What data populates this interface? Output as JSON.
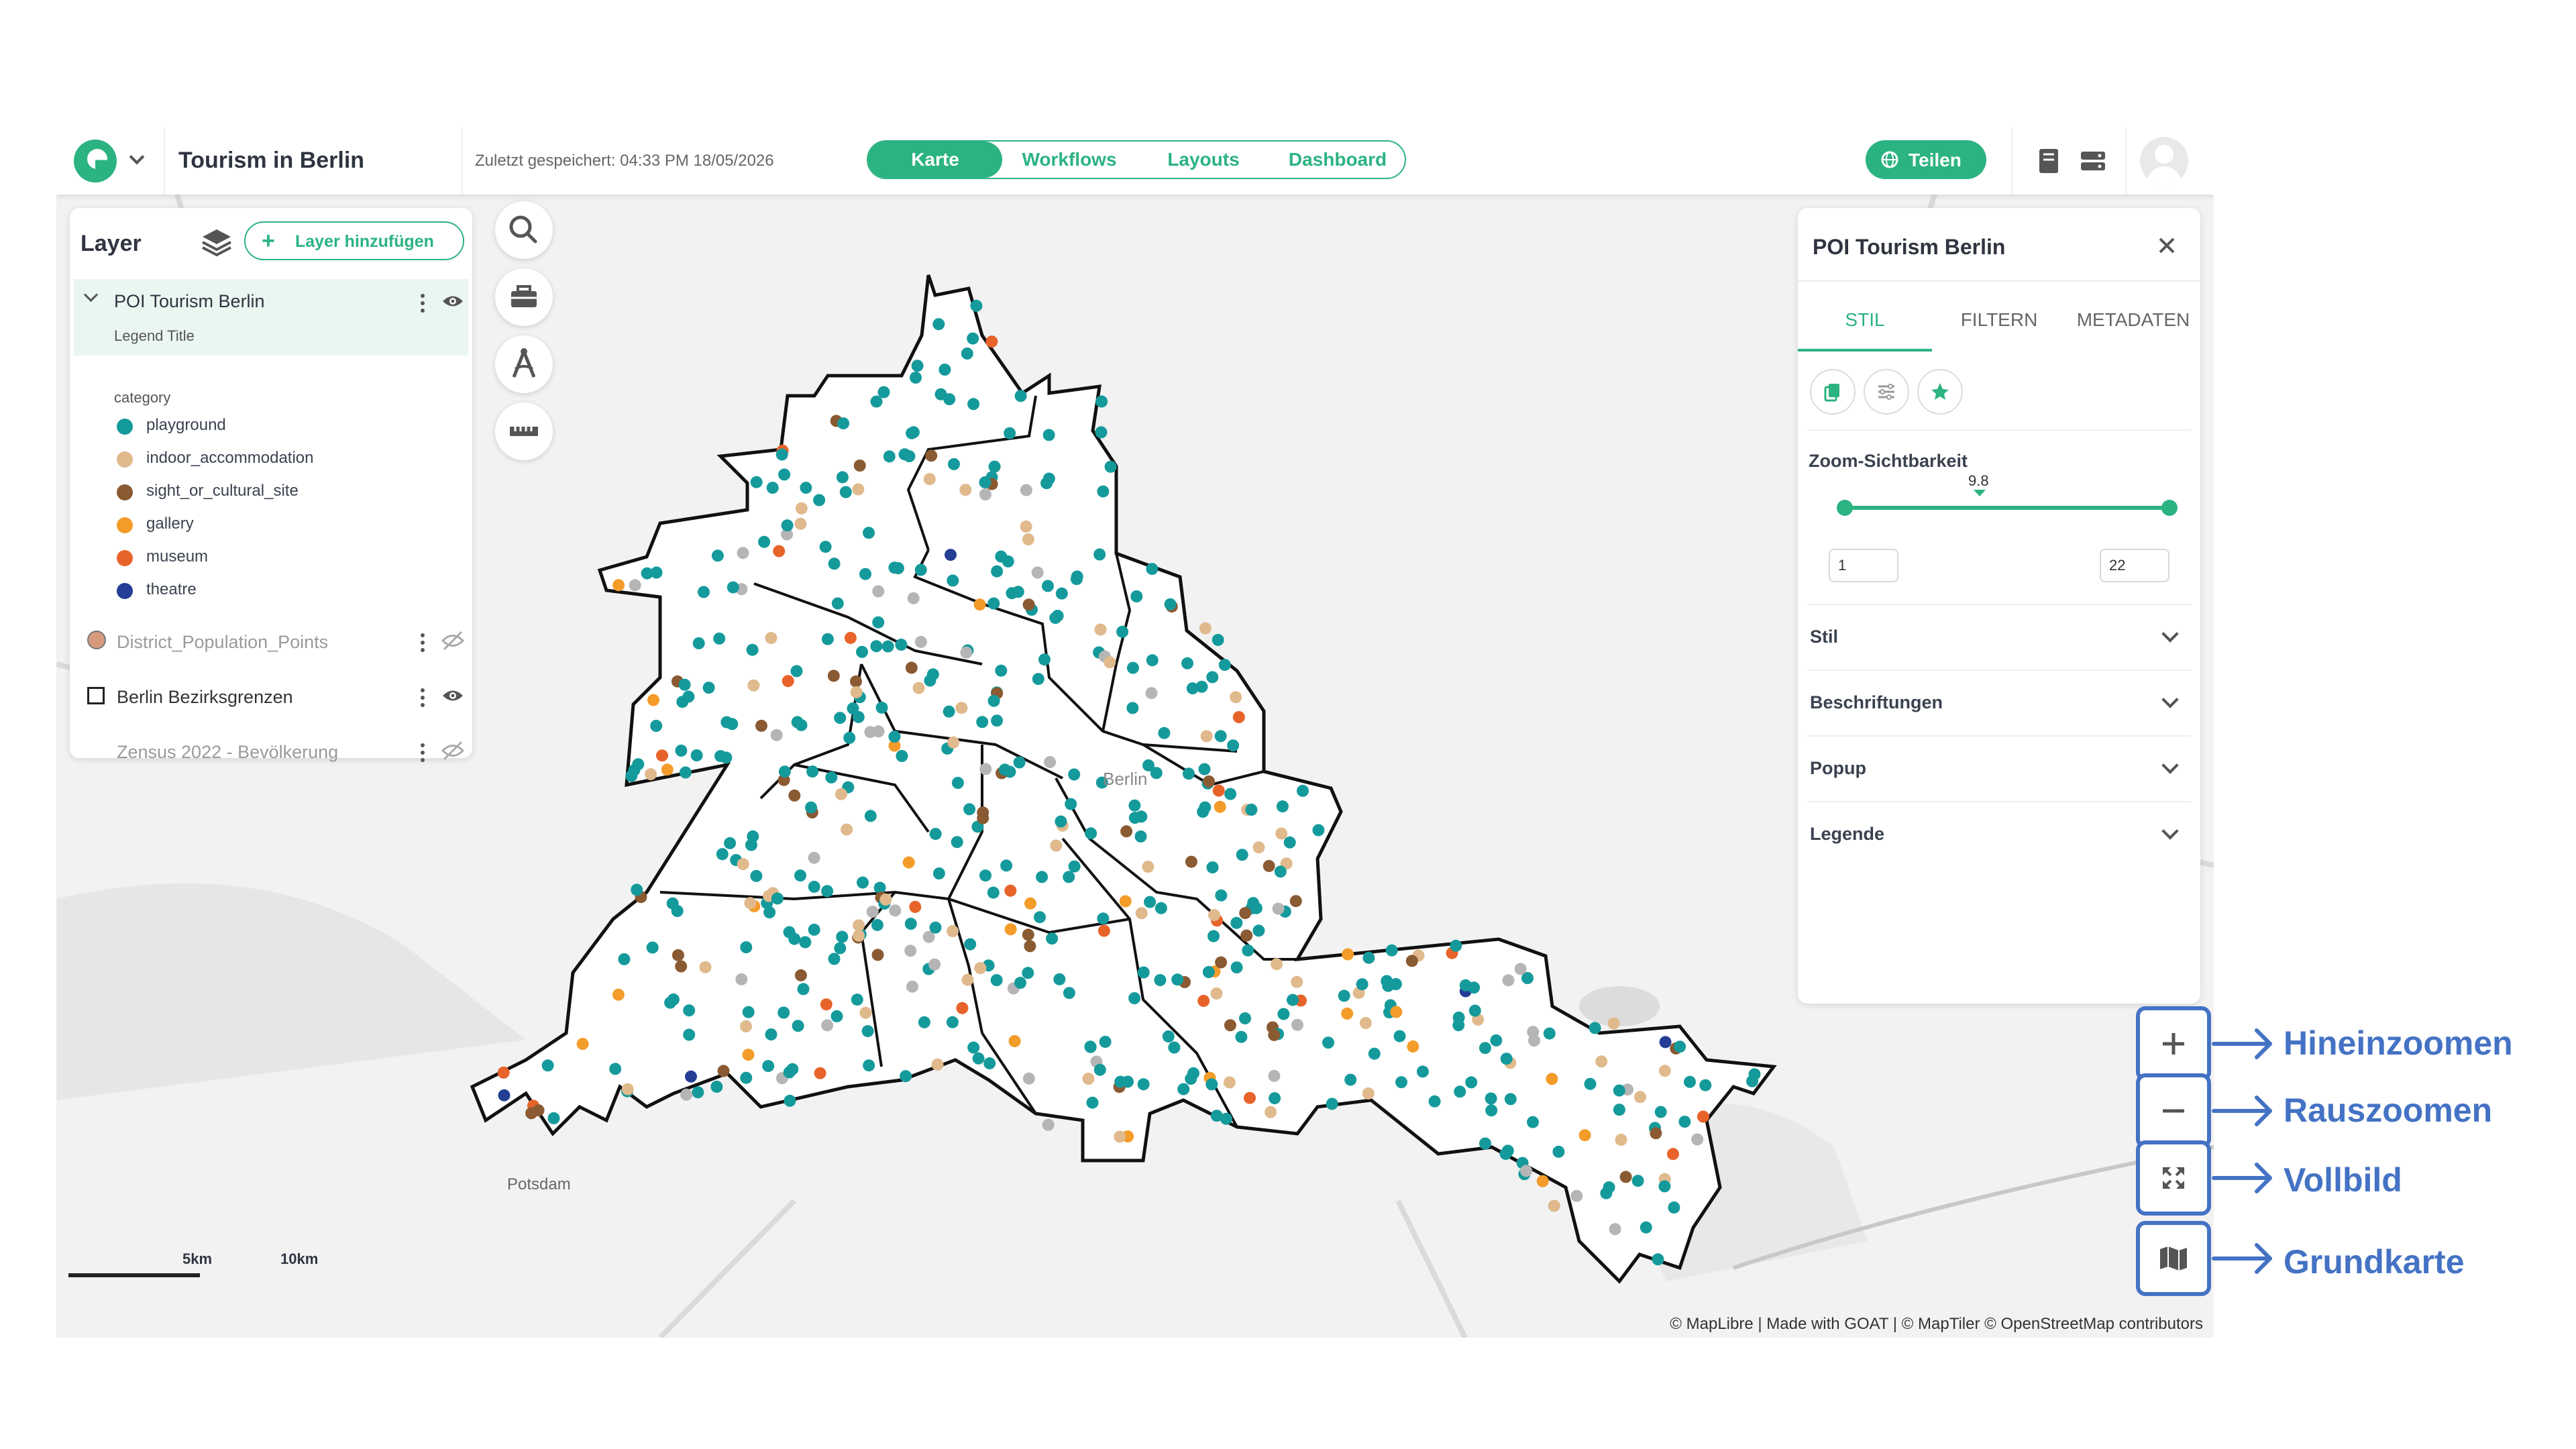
{
  "topbar": {
    "app_title": "Tourism in Berlin",
    "saved_status": "Zuletzt gespeichert: 04:33 PM 18/05/2026",
    "tabs": [
      {
        "label": "Karte",
        "active": true
      },
      {
        "label": "Workflows",
        "active": false
      },
      {
        "label": "Layouts",
        "active": false
      },
      {
        "label": "Dashboard",
        "active": false
      }
    ],
    "share_label": "Teilen",
    "accent_color": "#2bb381"
  },
  "layer_panel": {
    "title": "Layer",
    "add_layer_label": "Layer hinzufügen",
    "layers": [
      {
        "name": "POI Tourism Berlin",
        "legend_title": "Legend Title",
        "visible": true,
        "expanded": true
      },
      {
        "name": "District_Population_Points",
        "visible": false
      },
      {
        "name": "Berlin Bezirksgrenzen",
        "visible": true
      },
      {
        "name": "Zensus 2022 - Bevölkerung",
        "visible": false
      }
    ],
    "legend_field": "category",
    "legend_items": [
      {
        "label": "playground",
        "color": "#159a9c"
      },
      {
        "label": "indoor_accommodation",
        "color": "#e0b98c"
      },
      {
        "label": "sight_or_cultural_site",
        "color": "#8a5a32"
      },
      {
        "label": "gallery",
        "color": "#f39c2a"
      },
      {
        "label": "museum",
        "color": "#e8632a"
      },
      {
        "label": "theatre",
        "color": "#243e96"
      }
    ]
  },
  "map_tools": [
    "search-icon",
    "toolbox-icon",
    "measure-angle-icon",
    "ruler-icon"
  ],
  "map": {
    "city_label": "Berlin",
    "place_label": "Potsdam",
    "scale_labels": [
      "5km",
      "10km"
    ],
    "attribution": "© MapLibre | Made with GOAT | © MapTiler © OpenStreetMap contributors"
  },
  "right_panel": {
    "title": "POI Tourism Berlin",
    "tabs": [
      "STIL",
      "FILTERN",
      "METADATEN"
    ],
    "active_tab": "STIL",
    "zoom_label": "Zoom-Sichtbarkeit",
    "zoom_current": "9.8",
    "zoom_min": "1",
    "zoom_max": "22",
    "sections": [
      "Stil",
      "Beschriftungen",
      "Popup",
      "Legende"
    ]
  },
  "zoom_controls": [
    {
      "icon": "plus-icon",
      "annotation": "Hineinzoomen"
    },
    {
      "icon": "minus-icon",
      "annotation": "Rauszoomen"
    },
    {
      "icon": "fullscreen-icon",
      "annotation": "Vollbild"
    },
    {
      "icon": "basemap-icon",
      "annotation": "Grundkarte"
    }
  ]
}
